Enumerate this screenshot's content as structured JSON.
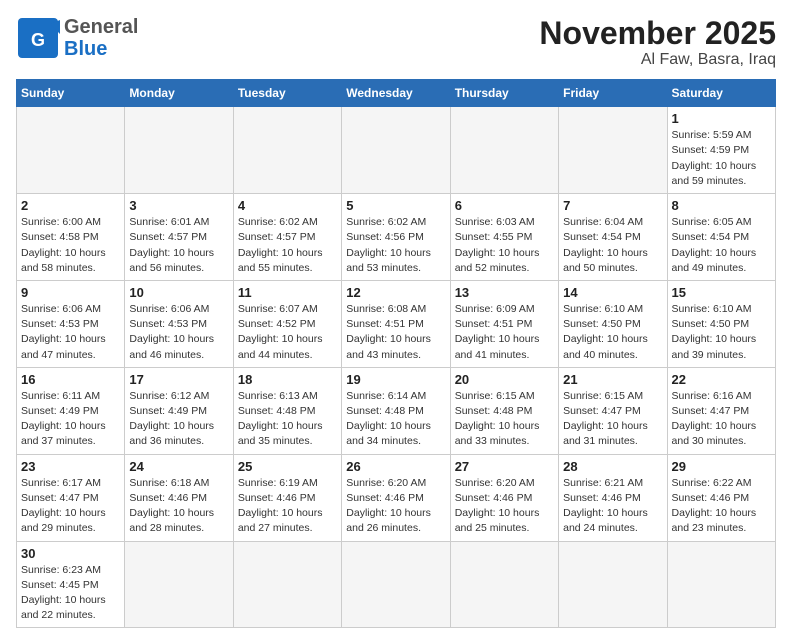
{
  "header": {
    "logo_general": "General",
    "logo_blue": "Blue",
    "month_title": "November 2025",
    "location": "Al Faw, Basra, Iraq"
  },
  "days_of_week": [
    "Sunday",
    "Monday",
    "Tuesday",
    "Wednesday",
    "Thursday",
    "Friday",
    "Saturday"
  ],
  "weeks": [
    [
      {
        "day": "",
        "info": ""
      },
      {
        "day": "",
        "info": ""
      },
      {
        "day": "",
        "info": ""
      },
      {
        "day": "",
        "info": ""
      },
      {
        "day": "",
        "info": ""
      },
      {
        "day": "",
        "info": ""
      },
      {
        "day": "1",
        "info": "Sunrise: 5:59 AM\nSunset: 4:59 PM\nDaylight: 10 hours\nand 59 minutes."
      }
    ],
    [
      {
        "day": "2",
        "info": "Sunrise: 6:00 AM\nSunset: 4:58 PM\nDaylight: 10 hours\nand 58 minutes."
      },
      {
        "day": "3",
        "info": "Sunrise: 6:01 AM\nSunset: 4:57 PM\nDaylight: 10 hours\nand 56 minutes."
      },
      {
        "day": "4",
        "info": "Sunrise: 6:02 AM\nSunset: 4:57 PM\nDaylight: 10 hours\nand 55 minutes."
      },
      {
        "day": "5",
        "info": "Sunrise: 6:02 AM\nSunset: 4:56 PM\nDaylight: 10 hours\nand 53 minutes."
      },
      {
        "day": "6",
        "info": "Sunrise: 6:03 AM\nSunset: 4:55 PM\nDaylight: 10 hours\nand 52 minutes."
      },
      {
        "day": "7",
        "info": "Sunrise: 6:04 AM\nSunset: 4:54 PM\nDaylight: 10 hours\nand 50 minutes."
      },
      {
        "day": "8",
        "info": "Sunrise: 6:05 AM\nSunset: 4:54 PM\nDaylight: 10 hours\nand 49 minutes."
      }
    ],
    [
      {
        "day": "9",
        "info": "Sunrise: 6:06 AM\nSunset: 4:53 PM\nDaylight: 10 hours\nand 47 minutes."
      },
      {
        "day": "10",
        "info": "Sunrise: 6:06 AM\nSunset: 4:53 PM\nDaylight: 10 hours\nand 46 minutes."
      },
      {
        "day": "11",
        "info": "Sunrise: 6:07 AM\nSunset: 4:52 PM\nDaylight: 10 hours\nand 44 minutes."
      },
      {
        "day": "12",
        "info": "Sunrise: 6:08 AM\nSunset: 4:51 PM\nDaylight: 10 hours\nand 43 minutes."
      },
      {
        "day": "13",
        "info": "Sunrise: 6:09 AM\nSunset: 4:51 PM\nDaylight: 10 hours\nand 41 minutes."
      },
      {
        "day": "14",
        "info": "Sunrise: 6:10 AM\nSunset: 4:50 PM\nDaylight: 10 hours\nand 40 minutes."
      },
      {
        "day": "15",
        "info": "Sunrise: 6:10 AM\nSunset: 4:50 PM\nDaylight: 10 hours\nand 39 minutes."
      }
    ],
    [
      {
        "day": "16",
        "info": "Sunrise: 6:11 AM\nSunset: 4:49 PM\nDaylight: 10 hours\nand 37 minutes."
      },
      {
        "day": "17",
        "info": "Sunrise: 6:12 AM\nSunset: 4:49 PM\nDaylight: 10 hours\nand 36 minutes."
      },
      {
        "day": "18",
        "info": "Sunrise: 6:13 AM\nSunset: 4:48 PM\nDaylight: 10 hours\nand 35 minutes."
      },
      {
        "day": "19",
        "info": "Sunrise: 6:14 AM\nSunset: 4:48 PM\nDaylight: 10 hours\nand 34 minutes."
      },
      {
        "day": "20",
        "info": "Sunrise: 6:15 AM\nSunset: 4:48 PM\nDaylight: 10 hours\nand 33 minutes."
      },
      {
        "day": "21",
        "info": "Sunrise: 6:15 AM\nSunset: 4:47 PM\nDaylight: 10 hours\nand 31 minutes."
      },
      {
        "day": "22",
        "info": "Sunrise: 6:16 AM\nSunset: 4:47 PM\nDaylight: 10 hours\nand 30 minutes."
      }
    ],
    [
      {
        "day": "23",
        "info": "Sunrise: 6:17 AM\nSunset: 4:47 PM\nDaylight: 10 hours\nand 29 minutes."
      },
      {
        "day": "24",
        "info": "Sunrise: 6:18 AM\nSunset: 4:46 PM\nDaylight: 10 hours\nand 28 minutes."
      },
      {
        "day": "25",
        "info": "Sunrise: 6:19 AM\nSunset: 4:46 PM\nDaylight: 10 hours\nand 27 minutes."
      },
      {
        "day": "26",
        "info": "Sunrise: 6:20 AM\nSunset: 4:46 PM\nDaylight: 10 hours\nand 26 minutes."
      },
      {
        "day": "27",
        "info": "Sunrise: 6:20 AM\nSunset: 4:46 PM\nDaylight: 10 hours\nand 25 minutes."
      },
      {
        "day": "28",
        "info": "Sunrise: 6:21 AM\nSunset: 4:46 PM\nDaylight: 10 hours\nand 24 minutes."
      },
      {
        "day": "29",
        "info": "Sunrise: 6:22 AM\nSunset: 4:46 PM\nDaylight: 10 hours\nand 23 minutes."
      }
    ],
    [
      {
        "day": "30",
        "info": "Sunrise: 6:23 AM\nSunset: 4:45 PM\nDaylight: 10 hours\nand 22 minutes."
      },
      {
        "day": "",
        "info": ""
      },
      {
        "day": "",
        "info": ""
      },
      {
        "day": "",
        "info": ""
      },
      {
        "day": "",
        "info": ""
      },
      {
        "day": "",
        "info": ""
      },
      {
        "day": "",
        "info": ""
      }
    ]
  ]
}
